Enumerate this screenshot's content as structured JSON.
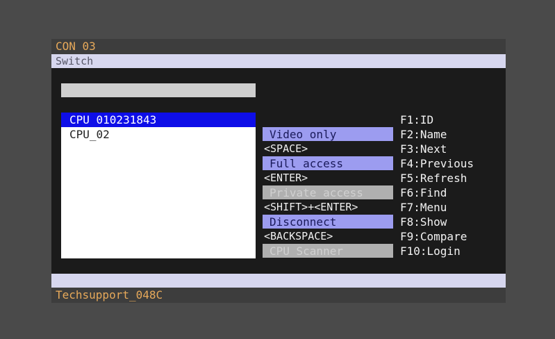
{
  "window": {
    "title": "CON 03",
    "menu": "Switch",
    "footer": "Techsupport_048C"
  },
  "search": {
    "value": ""
  },
  "cpu_list": {
    "items": [
      {
        "label": "CPU 010231843",
        "selected": true
      },
      {
        "label": "CPU_02",
        "selected": false
      }
    ]
  },
  "actions": {
    "video_only": {
      "label": "Video only",
      "key": "<SPACE>",
      "enabled": true
    },
    "full_access": {
      "label": "Full access",
      "key": "<ENTER>",
      "enabled": true
    },
    "private_access": {
      "label": "Private access",
      "key": "<SHIFT>+<ENTER>",
      "enabled": false
    },
    "disconnect": {
      "label": "Disconnect",
      "key": "<BACKSPACE>",
      "enabled": true
    },
    "cpu_scanner": {
      "label": "CPU Scanner",
      "enabled": false
    }
  },
  "function_keys": [
    "F1:ID",
    "F2:Name",
    "F3:Next",
    "F4:Previous",
    "F5:Refresh",
    "F6:Find",
    "F7:Menu",
    "F8:Show",
    "F9:Compare",
    "F10:Login"
  ],
  "colors": {
    "background": "#4a4a4a",
    "screen": "#1b1b1b",
    "title_text": "#e7a95a",
    "bar": "#d7d7ef",
    "selection": "#0e0ee8",
    "button_enabled": "#9c9cf0",
    "button_disabled": "#b0b0b0"
  }
}
